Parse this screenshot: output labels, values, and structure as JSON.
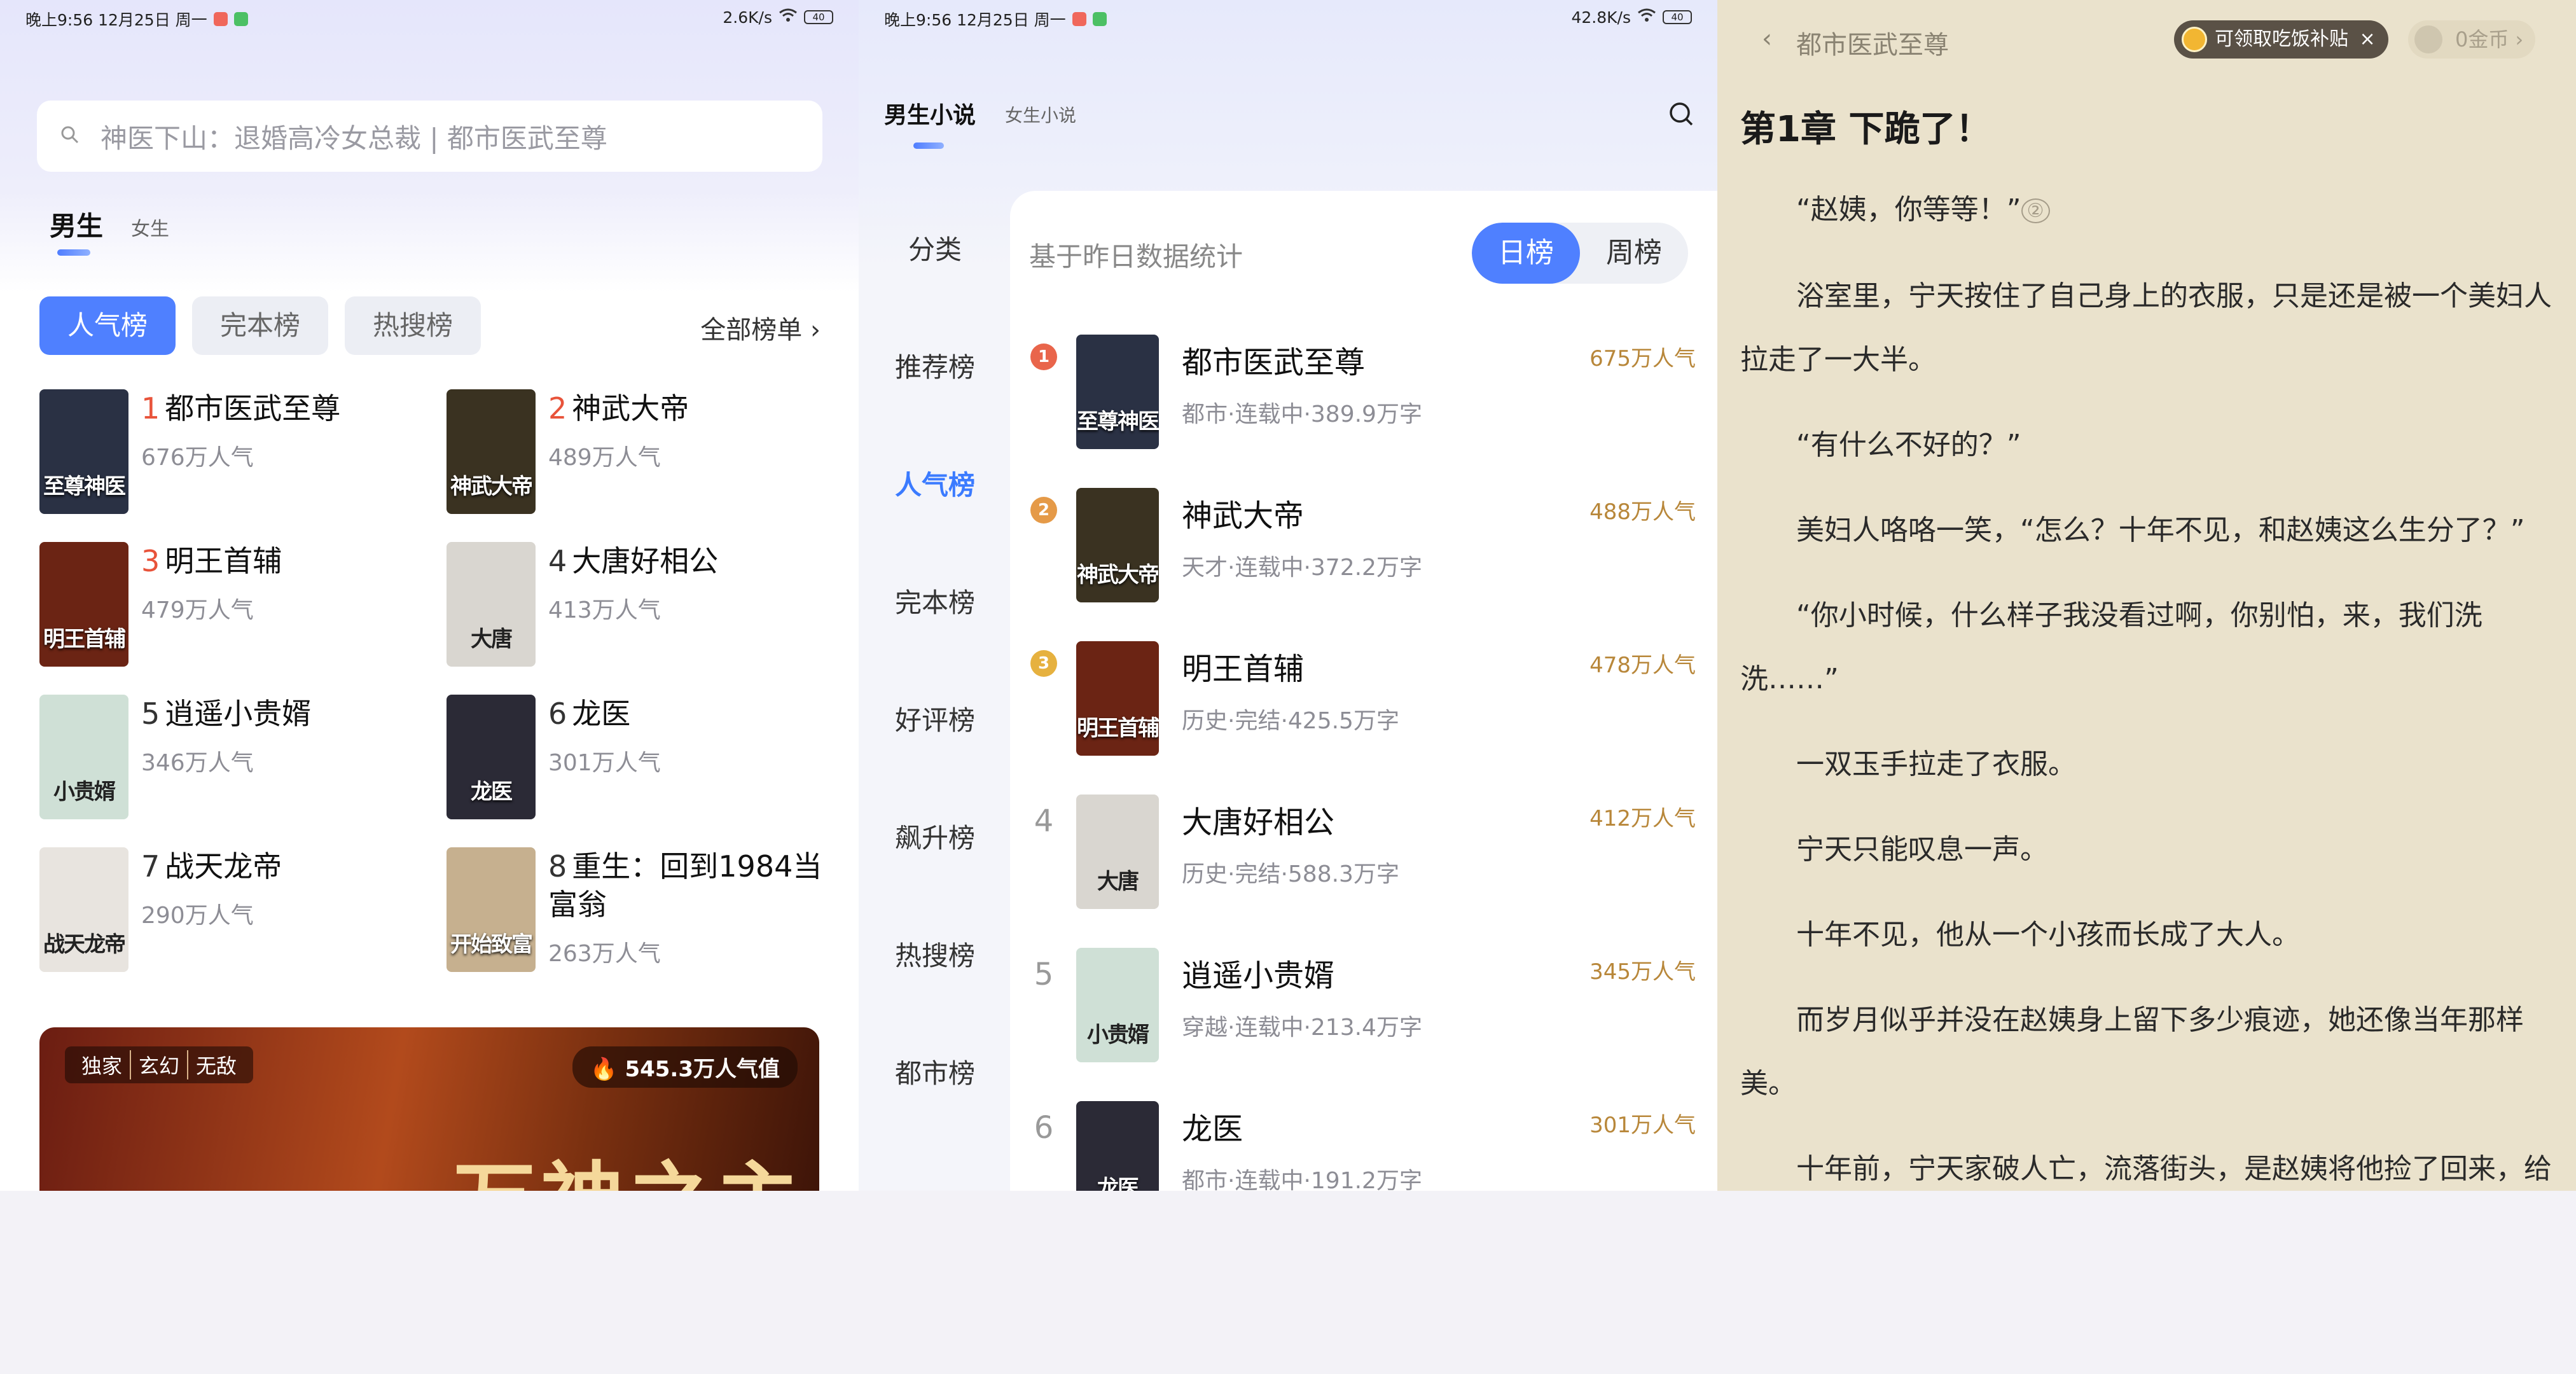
{
  "panel1": {
    "status": {
      "time": "晚上9:56 12月25日 周一",
      "speed": "2.6K/s",
      "battery": "40"
    },
    "search": {
      "placeholder": "神医下山：退婚高冷女总裁 | 都市医武至尊"
    },
    "gender_tabs": {
      "active": "男生",
      "other": "女生"
    },
    "chips": [
      "人气榜",
      "完本榜",
      "热搜榜"
    ],
    "all_lists": "全部榜单 ›",
    "ranks": [
      {
        "no": "1",
        "title": "都市医武至尊",
        "pop": "676万人气",
        "cover_text": "至尊神医",
        "color": "#2a3144"
      },
      {
        "no": "2",
        "title": "神武大帝",
        "pop": "489万人气",
        "cover_text": "神武大帝",
        "color": "#3a3221"
      },
      {
        "no": "3",
        "title": "明王首辅",
        "pop": "479万人气",
        "cover_text": "明王首辅",
        "color": "#6b2414"
      },
      {
        "no": "4",
        "title": "大唐好相公",
        "pop": "413万人气",
        "cover_text": "大唐",
        "color": "#d9d6d0"
      },
      {
        "no": "5",
        "title": "逍遥小贵婿",
        "pop": "346万人气",
        "cover_text": "小贵婿",
        "color": "#cfe0d6"
      },
      {
        "no": "6",
        "title": "龙医",
        "pop": "301万人气",
        "cover_text": "龙医",
        "color": "#2b2a36"
      },
      {
        "no": "7",
        "title": "战天龙帝",
        "pop": "290万人气",
        "cover_text": "战天龙帝",
        "color": "#e8e4df"
      },
      {
        "no": "8",
        "title": "重生：回到1984当富翁",
        "pop": "263万人气",
        "cover_text": "开始致富",
        "color": "#c6b08f"
      }
    ],
    "banner": {
      "tags": [
        "独家",
        "玄幻",
        "无敌"
      ],
      "heat": "545.3万人气值",
      "title": "万神之主"
    }
  },
  "panel2": {
    "status": {
      "time": "晚上9:56 12月25日 周一",
      "speed": "42.8K/s",
      "battery": "40"
    },
    "tabs": {
      "active": "男生小说",
      "other": "女生小说"
    },
    "side": [
      "分类",
      "推荐榜",
      "人气榜",
      "完本榜",
      "好评榜",
      "飙升榜",
      "热搜榜",
      "都市榜"
    ],
    "note": "基于昨日数据统计",
    "segment": [
      "日榜",
      "周榜"
    ],
    "list": [
      {
        "no": "1",
        "title": "都市医武至尊",
        "meta": "都市·连载中·389.9万字",
        "pop": "675万人气",
        "cover_text": "至尊神医",
        "color": "#2a3144"
      },
      {
        "no": "2",
        "title": "神武大帝",
        "meta": "天才·连载中·372.2万字",
        "pop": "488万人气",
        "cover_text": "神武大帝",
        "color": "#3a3221"
      },
      {
        "no": "3",
        "title": "明王首辅",
        "meta": "历史·完结·425.5万字",
        "pop": "478万人气",
        "cover_text": "明王首辅",
        "color": "#6b2414"
      },
      {
        "no": "4",
        "title": "大唐好相公",
        "meta": "历史·完结·588.3万字",
        "pop": "412万人气",
        "cover_text": "大唐",
        "color": "#d9d6d0"
      },
      {
        "no": "5",
        "title": "逍遥小贵婿",
        "meta": "穿越·连载中·213.4万字",
        "pop": "345万人气",
        "cover_text": "小贵婿",
        "color": "#cfe0d6"
      },
      {
        "no": "6",
        "title": "龙医",
        "meta": "都市·连载中·191.2万字",
        "pop": "301万人气",
        "cover_text": "龙医",
        "color": "#2b2a36"
      }
    ]
  },
  "panel3": {
    "book_title": "都市医武至尊",
    "subsidy": "可领取吃饭补贴",
    "gold": "0金币 ›",
    "chapter": "第1章 下跪了！",
    "paragraphs": [
      "“赵姨，你等等！”",
      "浴室里，宁天按住了自己身上的衣服，只是还是被一个美妇人拉走了一大半。",
      "“有什么不好的？”",
      "美妇人咯咯一笑，“怎么？十年不见，和赵姨这么生分了？”",
      "“你小时候，什么样子我没看过啊，你别怕，来，我们洗洗……”",
      "一双玉手拉走了衣服。",
      "宁天只能叹息一声。",
      "十年不见，他从一个小孩而长成了大人。",
      "而岁月似乎并没在赵姨身上留下多少痕迹，她还像当年那样美。",
      "十年前，宁天家破人亡，流落街头，是赵姨将他捡了回来，给"
    ],
    "note_mark": "②"
  }
}
